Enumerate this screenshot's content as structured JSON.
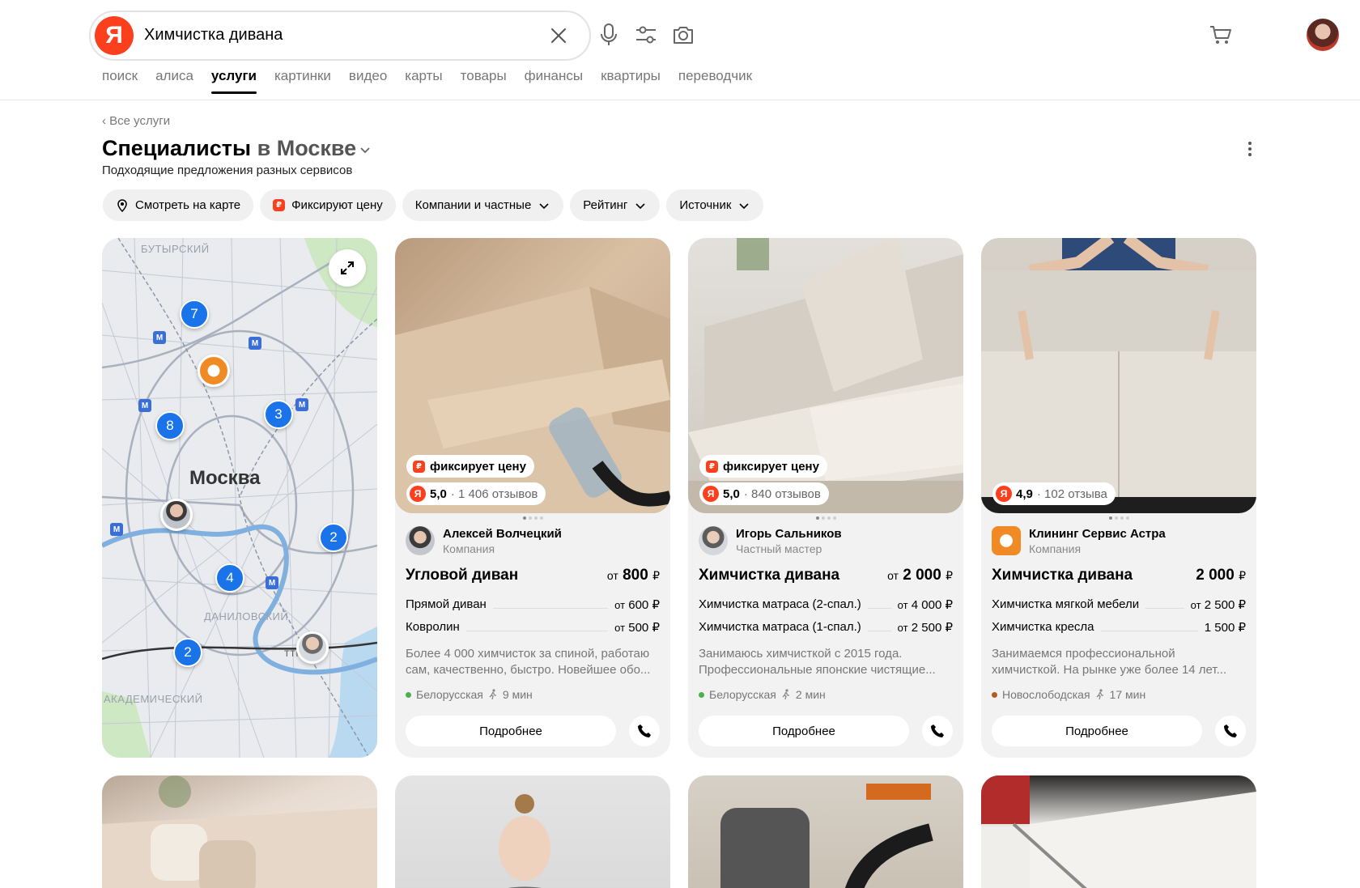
{
  "search": {
    "query": "Химчистка дивана",
    "logo": "Я"
  },
  "tabs": [
    "поиск",
    "алиса",
    "услуги",
    "картинки",
    "видео",
    "карты",
    "товары",
    "финансы",
    "квартиры",
    "переводчик"
  ],
  "active_tab": "услуги",
  "breadcrumb": "‹ Все услуги",
  "title": {
    "main": "Специалисты",
    "city": "в Москве"
  },
  "subtitle": "Подходящие предложения разных сервисов",
  "filters": {
    "map": "Смотреть на карте",
    "fixed": "Фиксируют цену",
    "companies": "Компании и частные",
    "rating": "Рейтинг",
    "source": "Источник"
  },
  "map": {
    "city": "Москва",
    "districts": [
      "БУТЫРСКИЙ",
      "ДАНИЛОВСКИЙ",
      "АКАДЕМИЧЕСКИЙ",
      "ТТК"
    ],
    "clusters": [
      "7",
      "8",
      "3",
      "2",
      "4",
      "2"
    ],
    "metro_icon": "М"
  },
  "cards": [
    {
      "fixed_label": "фиксирует цену",
      "rating": "5,0",
      "reviews": "· 1 406 отзывов",
      "provider": "Алексей Волчецкий",
      "provider_type": "Компания",
      "main_service": "Угловой диван",
      "main_price_prefix": "от",
      "main_price": "800",
      "rows": [
        {
          "name": "Прямой диван",
          "prefix": "от",
          "price": "600 ₽"
        },
        {
          "name": "Ковролин",
          "prefix": "от",
          "price": "500 ₽"
        }
      ],
      "description": "Более 4 000 химчисток за спиной, работаю сам, качественно, быстро. Новейшее обо...",
      "metro": "Белорусская",
      "walk": "9 мин",
      "metro_color": "#4caf50",
      "more": "Подробнее"
    },
    {
      "fixed_label": "фиксирует цену",
      "rating": "5,0",
      "reviews": "· 840 отзывов",
      "provider": "Игорь Сальников",
      "provider_type": "Частный мастер",
      "main_service": "Химчистка дивана",
      "main_price_prefix": "от",
      "main_price": "2 000",
      "rows": [
        {
          "name": "Химчистка матраса (2-спал.)",
          "prefix": "от",
          "price": "4 000 ₽"
        },
        {
          "name": "Химчистка матраса (1-спал.)",
          "prefix": "от",
          "price": "2 500 ₽"
        }
      ],
      "description": "Занимаюсь химчисткой с 2015 года. Профессиональные японские чистящие...",
      "metro": "Белорусская",
      "walk": "2 мин",
      "metro_color": "#4caf50",
      "more": "Подробнее"
    },
    {
      "rating": "4,9",
      "reviews": "· 102 отзыва",
      "provider": "Клининг Сервис Астра",
      "provider_type": "Компания",
      "main_service": "Химчистка дивана",
      "main_price_prefix": "",
      "main_price": "2 000",
      "rows": [
        {
          "name": "Химчистка мягкой мебели",
          "prefix": "от",
          "price": "2 500 ₽"
        },
        {
          "name": "Химчистка кресла",
          "prefix": "",
          "price": "1 500 ₽"
        }
      ],
      "description": "Занимаемся профессиональной химчисткой. На рынке уже более 14 лет...",
      "metro": "Новослободская",
      "walk": "17 мин",
      "metro_color": "#b35a1f",
      "more": "Подробнее"
    }
  ],
  "currency": "₽",
  "colors": {
    "brand": "#fc3f1d",
    "pin": "#1a73e8",
    "card_bg": "#f2f2f2"
  }
}
